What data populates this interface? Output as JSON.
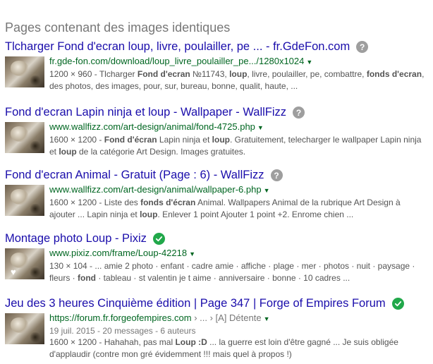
{
  "heading": "Pages contenant des images identiques",
  "results": [
    {
      "title": "Tlcharger Fond d'ecran loup, livre, poulailler, pe ... - fr.GdeFon.com",
      "badge": "?",
      "url": "fr.gde-fon.com/download/loup_livre_poulailler_pe.../1280x1024",
      "snippet": [
        {
          "t": "1200 × 960 - Tlcharger "
        },
        {
          "t": "Fond d'ecran",
          "b": true
        },
        {
          "t": " №11743, "
        },
        {
          "t": "loup",
          "b": true
        },
        {
          "t": ", livre, poulailler, pe, combattre, "
        },
        {
          "t": "fonds",
          "b": true
        },
        {
          "t": " "
        },
        {
          "t": "d'ecran",
          "b": true
        },
        {
          "t": ", des photos, des images, pour, sur, bureau, bonne, qualit, haute, ..."
        }
      ]
    },
    {
      "title": "Fond d'ecran Lapin ninja et loup - Wallpaper - WallFizz",
      "badge": "?",
      "url": "www.wallfizz.com/art-design/animal/fond-4725.php",
      "snippet": [
        {
          "t": "1600 × 1200 - "
        },
        {
          "t": "Fond d'écran",
          "b": true
        },
        {
          "t": " Lapin ninja et "
        },
        {
          "t": "loup",
          "b": true
        },
        {
          "t": ". Gratuitement, telecharger le wallpaper Lapin ninja et "
        },
        {
          "t": "loup",
          "b": true
        },
        {
          "t": " de la catégorie Art Design. Images gratuites."
        }
      ]
    },
    {
      "title": "Fond d'ecran Animal - Gratuit (Page : 6) - WallFizz",
      "badge": "?",
      "url": "www.wallfizz.com/art-design/animal/wallpaper-6.php",
      "snippet": [
        {
          "t": "1600 × 1200 - Liste des "
        },
        {
          "t": "fonds d'écran",
          "b": true
        },
        {
          "t": " Animal. Wallpapers Animal de la rubrique Art Design à ajouter ... Lapin ninja et "
        },
        {
          "t": "loup",
          "b": true
        },
        {
          "t": ". Enlever 1 point Ajouter 1 point +2. Enrome chien ..."
        }
      ]
    },
    {
      "title": "Montage photo Loup - Pixiz",
      "badge": "check",
      "url": "www.pixiz.com/frame/Loup-42218",
      "heart": true,
      "snippet": [
        {
          "t": "130 × 104 - ... amie 2 photo · enfant · cadre amie · affiche · plage · mer · photos · nuit · paysage · fleurs · "
        },
        {
          "t": "fond",
          "b": true
        },
        {
          "t": " · tableau · st valentin je t aime · anniversaire · bonne · 10 cadres ..."
        }
      ]
    },
    {
      "title": "Jeu des 3 heures Cinquième édition | Page 347 | Forge of Empires Forum",
      "badge": "check",
      "url": "https://forum.fr.forgeofempires.com",
      "url_rest": " › ... › [A] Détente",
      "date": "19 juil. 2015 - 20 messages - 6 auteurs",
      "snippet": [
        {
          "t": "1600 × 1200 - Hahahah, pas mal "
        },
        {
          "t": "Loup :D",
          "b": true
        },
        {
          "t": " ... la guerre est loin d'être gagné ... Je suis obligée d'applaudir (contre mon gré évidemment !!! mais quel à propos !)"
        }
      ]
    }
  ],
  "colors": {
    "title": "#1a0dab",
    "url": "#006621",
    "snippet": "#545454",
    "heading": "#777777",
    "badge_question": "#9e9e9e",
    "badge_check": "#21a84a"
  },
  "icons": {
    "question": "question-circle-icon",
    "check": "check-circle-icon",
    "dropdown": "triangle-down-icon"
  }
}
